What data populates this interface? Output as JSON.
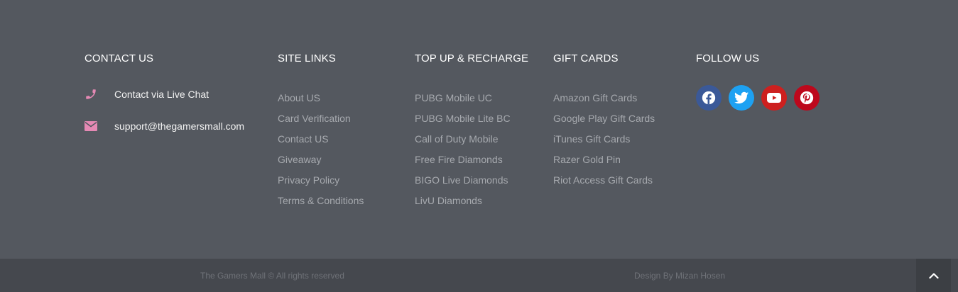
{
  "contact": {
    "heading": "CONTACT US",
    "items": [
      {
        "icon": "phone-icon",
        "label": "Contact via Live Chat"
      },
      {
        "icon": "envelope-icon",
        "label": "support@thegamersmall.com"
      }
    ],
    "icon_color": "#e589b4"
  },
  "site_links": {
    "heading": "SITE LINKS",
    "items": [
      "About US",
      "Card Verification",
      "Contact US",
      "Giveaway",
      "Privacy Policy",
      "Terms & Conditions"
    ]
  },
  "topup": {
    "heading": "TOP UP & RECHARGE",
    "items": [
      "PUBG Mobile UC",
      "PUBG Mobile Lite BC",
      "Call of Duty Mobile",
      "Free Fire Diamonds",
      "BIGO Live Diamonds",
      "LivU Diamonds"
    ]
  },
  "gift_cards": {
    "heading": "GIFT CARDS",
    "items": [
      "Amazon Gift Cards",
      "Google Play Gift Cards",
      "iTunes Gift Cards",
      "Razer Gold Pin",
      "Riot Access Gift Cards"
    ]
  },
  "follow": {
    "heading": "FOLLOW US",
    "networks": [
      {
        "icon": "facebook-icon",
        "color": "#3b5998"
      },
      {
        "icon": "twitter-icon",
        "color": "#1da1f2"
      },
      {
        "icon": "youtube-icon",
        "color": "#cd201f"
      },
      {
        "icon": "pinterest-icon",
        "color": "#bd081c"
      }
    ]
  },
  "bottom": {
    "copyright": "The Gamers Mall © All rights reserved",
    "credit": "Design By Mizan Hosen"
  },
  "colors": {
    "footer_bg": "#54585f",
    "bottom_bg": "#45484e",
    "link": "#a6a9ae"
  }
}
